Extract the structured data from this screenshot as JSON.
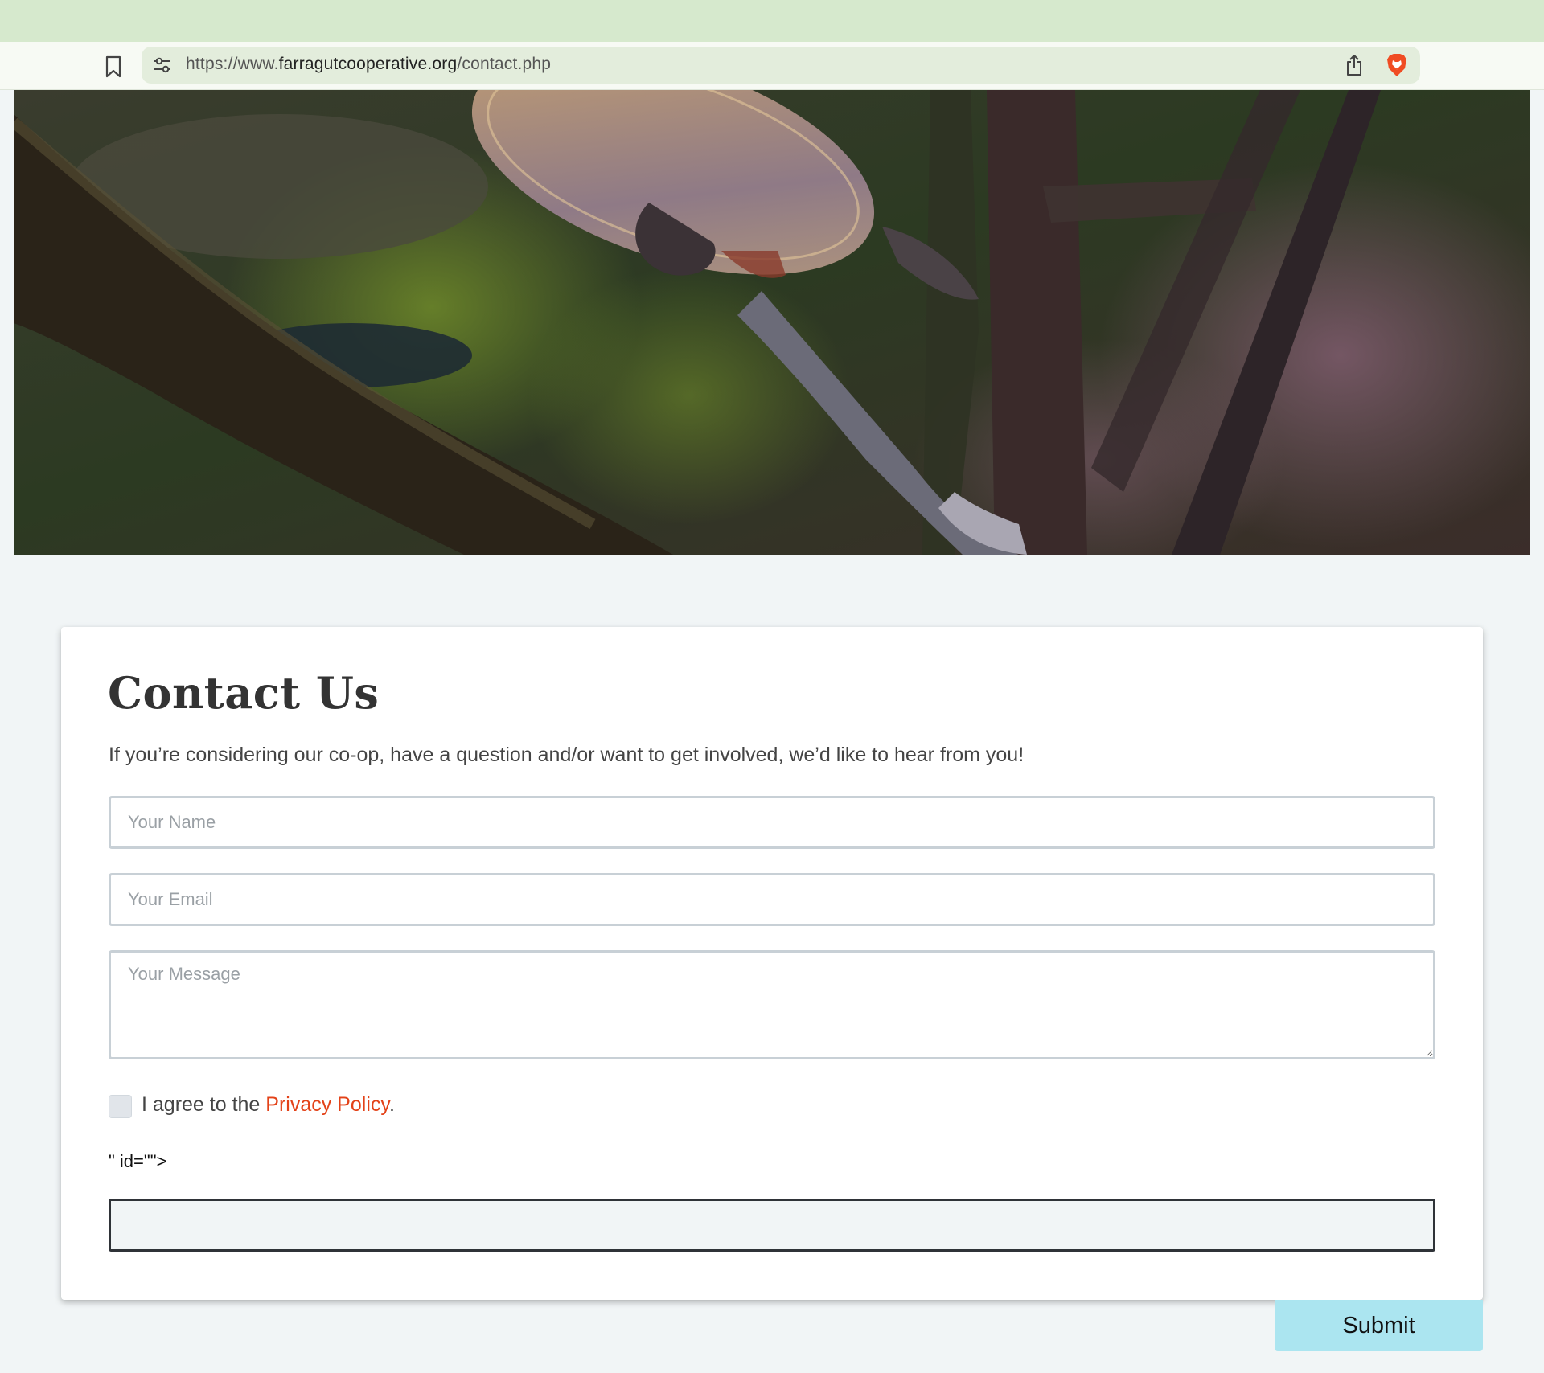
{
  "browser": {
    "url_prefix": "https://www.",
    "url_domain": "farragutcooperative.org",
    "url_path": "/contact.php",
    "icons": [
      "bookmark-icon",
      "site-info-icon",
      "share-icon",
      "brave-lion-icon"
    ]
  },
  "hero": {
    "subject": "turtle-swimming-among-submerged-branches"
  },
  "contact": {
    "title": "Contact Us",
    "intro": "If you’re considering our co-op, have a question and/or want to get involved, we’d like to hear from you!",
    "name_placeholder": "Your Name",
    "email_placeholder": "Your Email",
    "message_placeholder": "Your Message",
    "consent_prefix": "I agree to the ",
    "privacy_link": "Privacy Policy",
    "consent_suffix": ".",
    "stray_markup_text": "\" id=\"\">",
    "extra_field_value": "",
    "submit_label": "Submit"
  },
  "colors": {
    "tab_strip": "#d6e9cd",
    "page_background": "#f1f5f6",
    "link": "#e34218",
    "submit_button": "#abe5f0"
  }
}
